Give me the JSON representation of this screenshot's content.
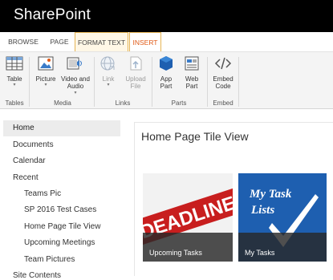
{
  "app": {
    "title": "SharePoint"
  },
  "tabs": [
    "BROWSE",
    "PAGE",
    "FORMAT TEXT",
    "INSERT"
  ],
  "ribbon": {
    "buttons": {
      "table": {
        "label": "Table"
      },
      "picture": {
        "label": "Picture"
      },
      "video": {
        "label1": "Video and",
        "label2": "Audio"
      },
      "link": {
        "label": "Link"
      },
      "upload": {
        "label1": "Upload",
        "label2": "File"
      },
      "apppart": {
        "label1": "App",
        "label2": "Part"
      },
      "webpart": {
        "label1": "Web",
        "label2": "Part"
      },
      "embed": {
        "label1": "Embed",
        "label2": "Code"
      }
    },
    "groups": [
      "Tables",
      "Media",
      "Links",
      "Parts",
      "Embed"
    ]
  },
  "nav": {
    "home": "Home",
    "documents": "Documents",
    "calendar": "Calendar",
    "recent": "Recent",
    "recent_items": [
      "Teams Pic",
      "SP 2016 Test Cases",
      "Home Page Tile View",
      "Upcoming Meetings",
      "Team Pictures"
    ],
    "site_contents": "Site Contents"
  },
  "main": {
    "title": "Home Page Tile View",
    "tiles": [
      {
        "label": "Upcoming Tasks",
        "image_text": "DEADLINE"
      },
      {
        "label": "My Tasks",
        "image_text_1": "My Task",
        "image_text_2": "Lists"
      }
    ]
  },
  "colors": {
    "topbar": "#000000",
    "accent": "#e05a16",
    "blue": "#1e5fb0"
  }
}
